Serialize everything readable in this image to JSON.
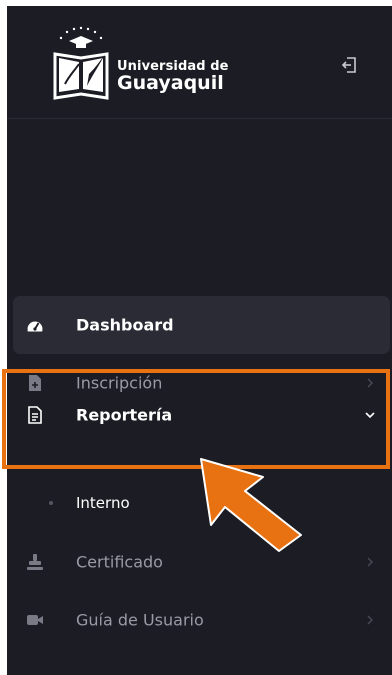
{
  "brand": {
    "line1": "Universidad de",
    "line2": "Guayaquil",
    "logo_icon": "university-crest-icon"
  },
  "header": {
    "collapse_icon": "collapse-sidebar-icon"
  },
  "menu": [
    {
      "label": "Dashboard",
      "icon": "dashboard-gauge-icon",
      "state": "active"
    },
    {
      "label": "Inscripción",
      "icon": "document-plus-icon",
      "state": "dim",
      "has_chevron": true
    },
    {
      "label": "Reportería",
      "icon": "report-document-icon",
      "state": "expanded",
      "has_chevron": true,
      "children": [
        {
          "label": "Interno"
        }
      ]
    },
    {
      "label": "Certificado",
      "icon": "stamp-icon",
      "state": "dim",
      "has_chevron": true
    },
    {
      "label": "Guía de Usuario",
      "icon": "video-camera-icon",
      "state": "dim",
      "has_chevron": true
    }
  ],
  "colors": {
    "sidebar_bg": "#1c1c24",
    "active_bg": "#2b2b35",
    "highlight": "#e87211",
    "dim_text": "#9a9aa6"
  }
}
